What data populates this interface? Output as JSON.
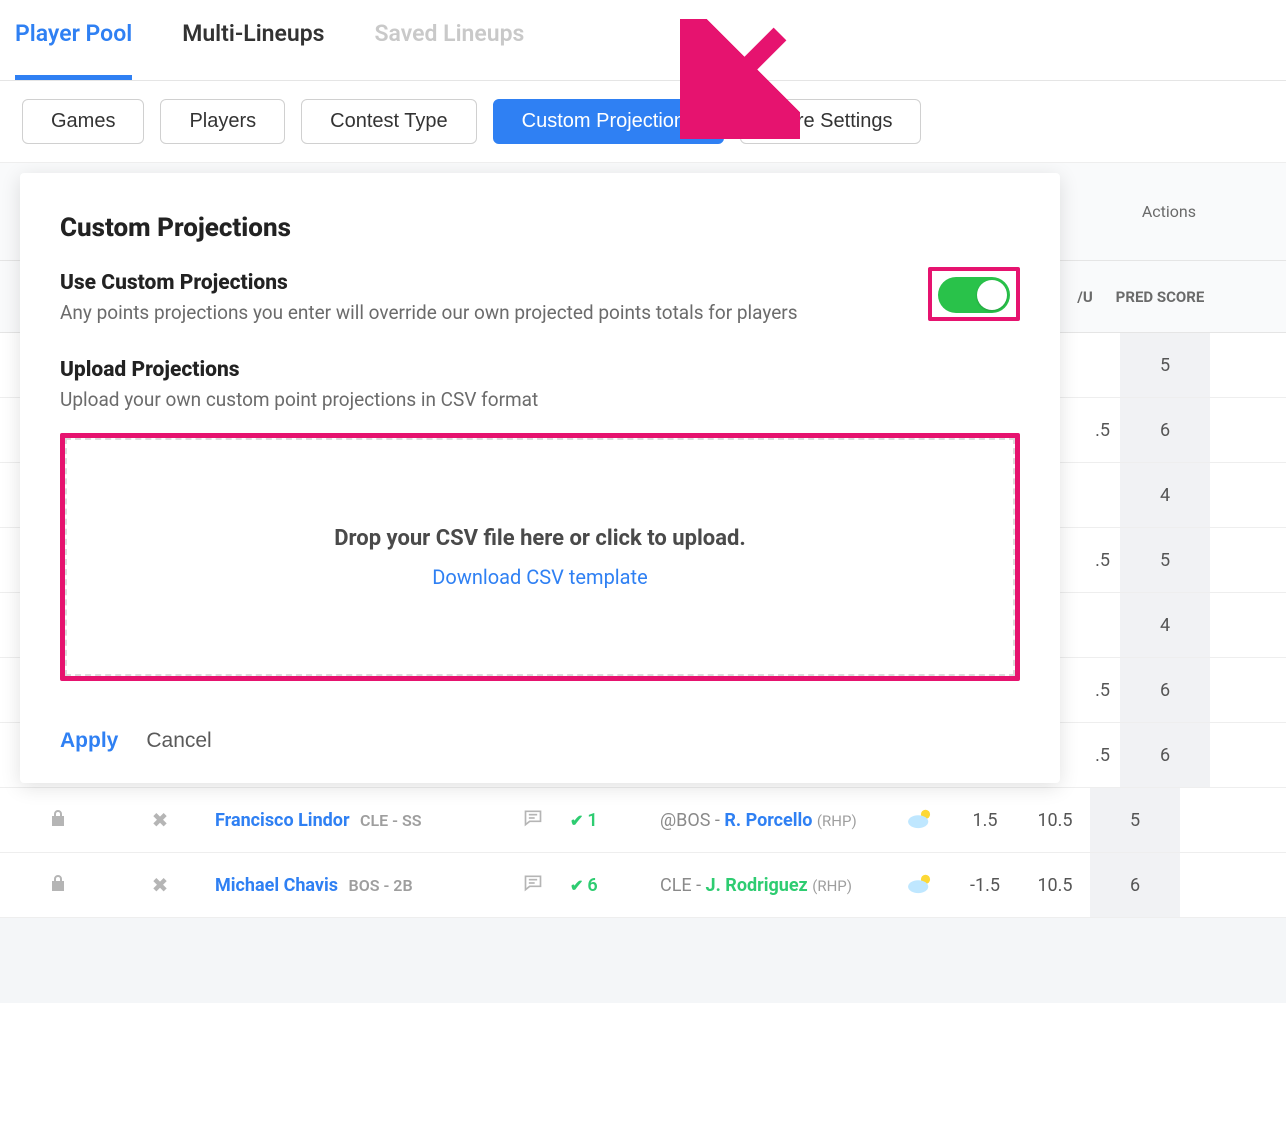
{
  "tabs": {
    "main": [
      {
        "label": "Player Pool",
        "state": "active"
      },
      {
        "label": "Multi-Lineups",
        "state": ""
      },
      {
        "label": "Saved Lineups",
        "state": "disabled"
      }
    ],
    "filters": [
      {
        "label": "Games",
        "state": ""
      },
      {
        "label": "Players",
        "state": ""
      },
      {
        "label": "Contest Type",
        "state": ""
      },
      {
        "label": "Custom Projections",
        "state": "active"
      },
      {
        "label": "More Settings",
        "state": ""
      }
    ]
  },
  "bg": {
    "actions_label": "Actions",
    "header_u": "/U",
    "header_pred": "PRED SCORE",
    "partial_rows": [
      {
        "ou": "",
        "pred": "5"
      },
      {
        "ou": ".5",
        "pred": "6"
      },
      {
        "ou": "",
        "pred": "4"
      },
      {
        "ou": ".5",
        "pred": "5"
      },
      {
        "ou": "",
        "pred": "4"
      },
      {
        "ou": ".5",
        "pred": "6"
      },
      {
        "ou": ".5",
        "pred": "6"
      }
    ]
  },
  "rows": [
    {
      "name": "Francisco Lindor",
      "team": "CLE - SS",
      "check_num": "1",
      "opp_at": "@BOS - ",
      "opp_pitcher": "R. Porcello",
      "opp_hand": "(RHP)",
      "pitcher_color": "blue",
      "num1": "1.5",
      "num2": "10.5",
      "pred": "5"
    },
    {
      "name": "Michael Chavis",
      "team": "BOS - 2B",
      "check_num": "6",
      "opp_at": "CLE - ",
      "opp_pitcher": "J. Rodriguez",
      "opp_hand": "(RHP)",
      "pitcher_color": "green",
      "num1": "-1.5",
      "num2": "10.5",
      "pred": "6"
    }
  ],
  "dialog": {
    "title": "Custom Projections",
    "use": {
      "title": "Use Custom Projections",
      "desc": "Any points projections you enter will override our own projected points totals for players"
    },
    "toggle_on": true,
    "upload": {
      "title": "Upload Projections",
      "desc": "Upload your own custom point projections in CSV format"
    },
    "dropzone_text": "Drop your CSV file here or click to upload.",
    "download_link": "Download CSV template",
    "apply": "Apply",
    "cancel": "Cancel"
  }
}
